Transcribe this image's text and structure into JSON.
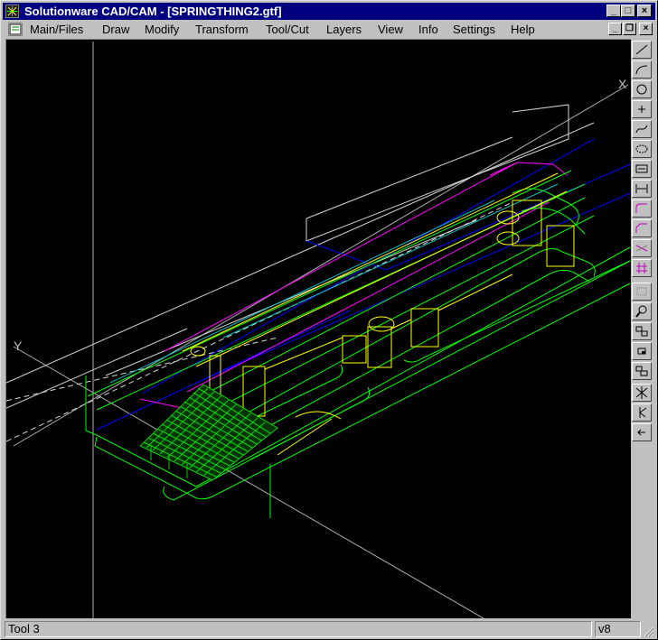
{
  "window": {
    "title": "Solutionware CAD/CAM - [SPRINGTHING2.gtf]",
    "buttons": {
      "minimize": "_",
      "maximize": "□",
      "close": "×"
    },
    "mdi_buttons": {
      "minimize": "_",
      "restore": "❐",
      "close": "×"
    }
  },
  "menu": {
    "items": [
      "Main/Files",
      "Draw",
      "Modify",
      "Transform",
      "Tool/Cut",
      "Layers",
      "View",
      "Info",
      "Settings",
      "Help"
    ]
  },
  "canvas": {
    "axis_x_label": "X",
    "axis_y_label": "Y",
    "colors": {
      "background": "#000000",
      "green": "#00ff00",
      "yellow": "#ffff00",
      "magenta": "#ff00ff",
      "blue": "#0000ff",
      "white": "#d8d8d8",
      "cyan": "#00c0c0"
    }
  },
  "toolbox": {
    "tools": [
      "line-tool-icon",
      "arc-tool-icon",
      "circle-tool-icon",
      "point-tool-icon",
      "spline-tool-icon",
      "ellipse-tool-icon",
      "text-tool-icon",
      "dimension-tool-icon",
      "fillet-tool-icon",
      "chamfer-tool-icon",
      "trim-tool-icon",
      "hatch-tool-icon",
      "snap-grid-icon",
      "zoom-icon",
      "zoom-window-icon",
      "zoom-previous-icon",
      "zoom-all-icon",
      "axis-tool-icon",
      "pointer-tool-icon",
      "redraw-icon"
    ]
  },
  "status": {
    "left": "Tool 3",
    "right": "v8"
  }
}
